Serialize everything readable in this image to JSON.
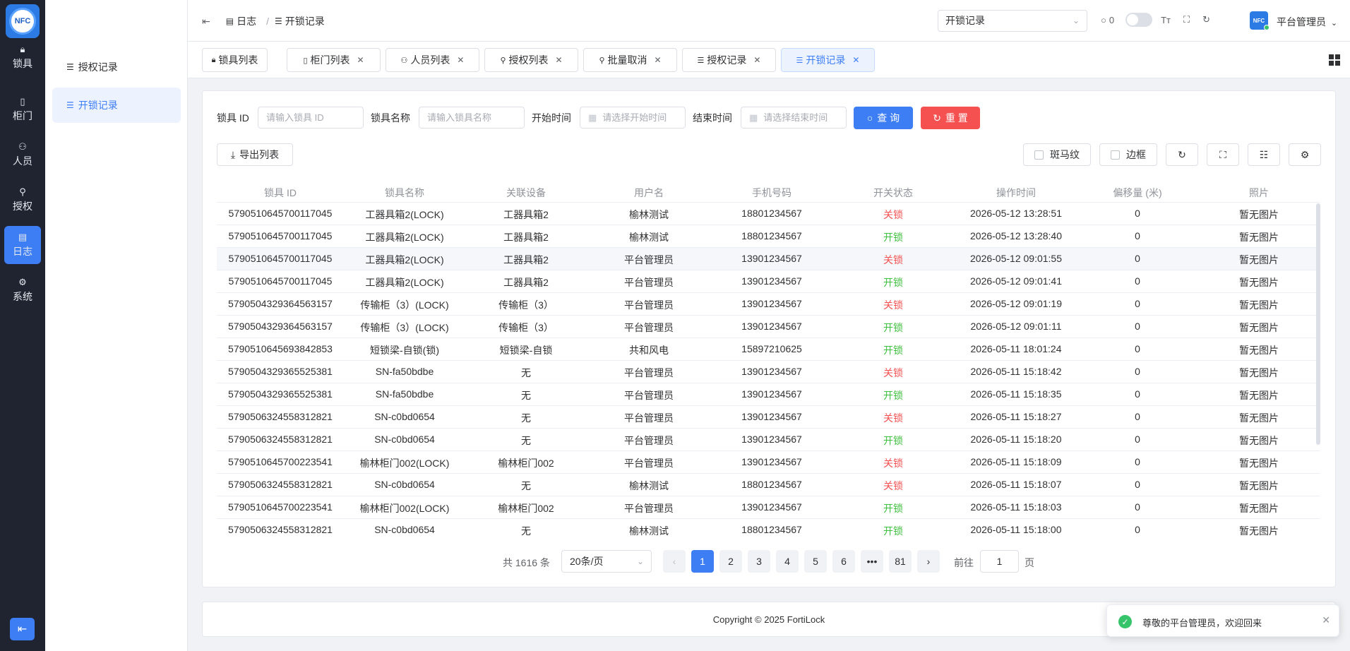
{
  "app": {
    "logo_text": "NFC"
  },
  "rail": {
    "items": [
      {
        "label": "锁具",
        "icon": "lock-icon"
      },
      {
        "label": "柜门",
        "icon": "door-icon"
      },
      {
        "label": "人员",
        "icon": "users-icon"
      },
      {
        "label": "授权",
        "icon": "user-key-icon"
      },
      {
        "label": "日志",
        "icon": "log-icon"
      },
      {
        "label": "系统",
        "icon": "settings-icon"
      }
    ],
    "active": "日志"
  },
  "submenu": {
    "items": [
      {
        "label": "授权记录"
      },
      {
        "label": "开锁记录"
      }
    ],
    "active": "开锁记录"
  },
  "header": {
    "breadcrumb": [
      "日志",
      "开锁记录"
    ],
    "select_value": "开锁记录",
    "message_count": "0",
    "user_name": "平台管理员",
    "avatar_text": "NFC"
  },
  "tabs": [
    {
      "label": "锁具列表",
      "closable": false
    },
    {
      "label": "柜门列表",
      "closable": true
    },
    {
      "label": "人员列表",
      "closable": true
    },
    {
      "label": "授权列表",
      "closable": true
    },
    {
      "label": "批量取消",
      "closable": true
    },
    {
      "label": "授权记录",
      "closable": true
    },
    {
      "label": "开锁记录",
      "closable": true,
      "active": true
    }
  ],
  "filters": {
    "lock_id_label": "锁具 ID",
    "lock_id_placeholder": "请输入锁具 ID",
    "lock_name_label": "锁具名称",
    "lock_name_placeholder": "请输入锁具名称",
    "start_label": "开始时间",
    "start_placeholder": "请选择开始时间",
    "end_label": "结束时间",
    "end_placeholder": "请选择结束时间",
    "query_label": "查 询",
    "reset_label": "重 置"
  },
  "toolbar": {
    "export_label": "导出列表",
    "stripe_label": "斑马纹",
    "border_label": "边框"
  },
  "table": {
    "columns": [
      "锁具 ID",
      "锁具名称",
      "关联设备",
      "用户名",
      "手机号码",
      "开关状态",
      "操作时间",
      "偏移量 (米)",
      "照片"
    ],
    "rows": [
      [
        "5790510645700117045",
        "工器具箱2(LOCK)",
        "工器具箱2",
        "榆林测试",
        "18801234567",
        "关锁",
        "2026-05-12 13:28:51",
        "0",
        "暂无图片"
      ],
      [
        "5790510645700117045",
        "工器具箱2(LOCK)",
        "工器具箱2",
        "榆林测试",
        "18801234567",
        "开锁",
        "2026-05-12 13:28:40",
        "0",
        "暂无图片"
      ],
      [
        "5790510645700117045",
        "工器具箱2(LOCK)",
        "工器具箱2",
        "平台管理员",
        "13901234567",
        "关锁",
        "2026-05-12 09:01:55",
        "0",
        "暂无图片"
      ],
      [
        "5790510645700117045",
        "工器具箱2(LOCK)",
        "工器具箱2",
        "平台管理员",
        "13901234567",
        "开锁",
        "2026-05-12 09:01:41",
        "0",
        "暂无图片"
      ],
      [
        "5790504329364563157",
        "传输柜（3）(LOCK)",
        "传输柜（3）",
        "平台管理员",
        "13901234567",
        "关锁",
        "2026-05-12 09:01:19",
        "0",
        "暂无图片"
      ],
      [
        "5790504329364563157",
        "传输柜（3）(LOCK)",
        "传输柜（3）",
        "平台管理员",
        "13901234567",
        "开锁",
        "2026-05-12 09:01:11",
        "0",
        "暂无图片"
      ],
      [
        "5790510645693842853",
        "短锁梁-自锁(锁)",
        "短锁梁-自锁",
        "共和风电",
        "15897210625",
        "开锁",
        "2026-05-11 18:01:24",
        "0",
        "暂无图片"
      ],
      [
        "5790504329365525381",
        "SN-fa50bdbe",
        "无",
        "平台管理员",
        "13901234567",
        "关锁",
        "2026-05-11 15:18:42",
        "0",
        "暂无图片"
      ],
      [
        "5790504329365525381",
        "SN-fa50bdbe",
        "无",
        "平台管理员",
        "13901234567",
        "开锁",
        "2026-05-11 15:18:35",
        "0",
        "暂无图片"
      ],
      [
        "5790506324558312821",
        "SN-c0bd0654",
        "无",
        "平台管理员",
        "13901234567",
        "关锁",
        "2026-05-11 15:18:27",
        "0",
        "暂无图片"
      ],
      [
        "5790506324558312821",
        "SN-c0bd0654",
        "无",
        "平台管理员",
        "13901234567",
        "开锁",
        "2026-05-11 15:18:20",
        "0",
        "暂无图片"
      ],
      [
        "5790510645700223541",
        "榆林柜门002(LOCK)",
        "榆林柜门002",
        "平台管理员",
        "13901234567",
        "关锁",
        "2026-05-11 15:18:09",
        "0",
        "暂无图片"
      ],
      [
        "5790506324558312821",
        "SN-c0bd0654",
        "无",
        "榆林测试",
        "18801234567",
        "关锁",
        "2026-05-11 15:18:07",
        "0",
        "暂无图片"
      ],
      [
        "5790510645700223541",
        "榆林柜门002(LOCK)",
        "榆林柜门002",
        "平台管理员",
        "13901234567",
        "开锁",
        "2026-05-11 15:18:03",
        "0",
        "暂无图片"
      ],
      [
        "5790506324558312821",
        "SN-c0bd0654",
        "无",
        "榆林测试",
        "18801234567",
        "开锁",
        "2026-05-11 15:18:00",
        "0",
        "暂无图片"
      ]
    ],
    "highlight_row": 2,
    "status_colors": {
      "关锁": "#f55151",
      "开锁": "#3fbf3f"
    }
  },
  "pagination": {
    "total_text": "共 1616 条",
    "page_size": "20条/页",
    "pages": [
      "1",
      "2",
      "3",
      "4",
      "5",
      "6",
      "•••",
      "81"
    ],
    "current": "1",
    "goto_label": "前往",
    "goto_value": "1",
    "page_suffix": "页"
  },
  "footer": {
    "copyright": "Copyright © 2025 FortiLock"
  },
  "toast": {
    "message": "尊敬的平台管理员，欢迎回来"
  },
  "colors": {
    "primary": "#3d7ef5",
    "danger": "#f55151",
    "success": "#35c46a",
    "rail_bg": "#1f2430"
  }
}
